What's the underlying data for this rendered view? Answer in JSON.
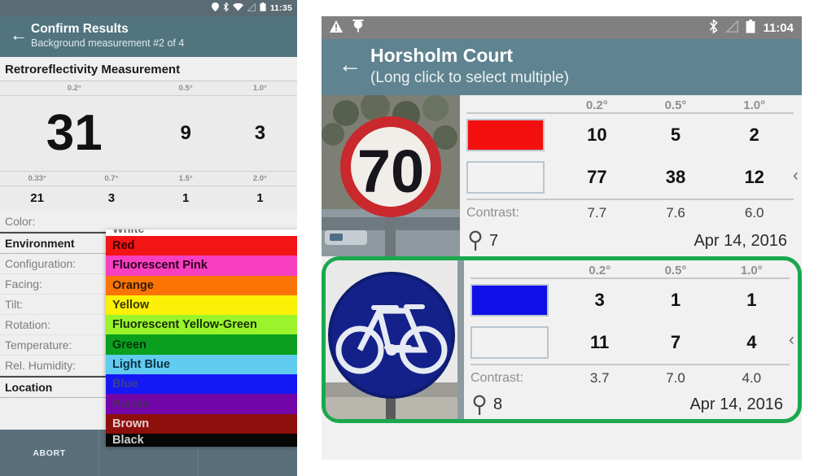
{
  "left_phone": {
    "statusbar": {
      "icons": [
        "location-pin-icon",
        "bluetooth-icon",
        "wifi-icon",
        "signal-icon",
        "battery-icon"
      ],
      "time": "11:35"
    },
    "appbar": {
      "back_icon": "back-arrow-icon",
      "title": "Confirm Results",
      "subtitle": "Background measurement #2 of 4"
    },
    "section_title": "Retroreflectivity Measurement",
    "measurement": {
      "angles_row1": [
        "0.2°",
        "0.5°",
        "1.0°"
      ],
      "values_row1": [
        "31",
        "9",
        "3"
      ],
      "angles_row2": [
        "0.33°",
        "0.7°",
        "1.5°",
        "2.0°"
      ],
      "values_row2": [
        "21",
        "3",
        "1",
        "1"
      ]
    },
    "fields": [
      {
        "label": "Color:",
        "value": ""
      },
      {
        "label": "Environment",
        "value": "",
        "header": true
      },
      {
        "label": "Configuration:",
        "value": ""
      },
      {
        "label": "Facing:",
        "value": ""
      },
      {
        "label": "Tilt:",
        "value": ""
      },
      {
        "label": "Rotation:",
        "value": ""
      },
      {
        "label": "Temperature:",
        "value": ""
      },
      {
        "label": "Rel. Humidity:",
        "value": ""
      },
      {
        "label": "Location",
        "value": "",
        "header": true
      }
    ],
    "buttons": [
      {
        "label": "ABORT"
      },
      {
        "label": ""
      },
      {
        "label": ""
      }
    ],
    "color_dropdown": {
      "items": [
        {
          "label": "White",
          "bg": "#ffffff",
          "fg": "#6b6b6b"
        },
        {
          "label": "Red",
          "bg": "#f21515",
          "fg": "#3a0000"
        },
        {
          "label": "Fluorescent Pink",
          "bg": "#f73fc0",
          "fg": "#2b0021"
        },
        {
          "label": "Orange",
          "bg": "#fb7406",
          "fg": "#3a1a00"
        },
        {
          "label": "Yellow",
          "bg": "#fcf106",
          "fg": "#3a3600"
        },
        {
          "label": "Fluorescent Yellow-Green",
          "bg": "#9bf32b",
          "fg": "#17300a"
        },
        {
          "label": "Green",
          "bg": "#0aa01d",
          "fg": "#03330a"
        },
        {
          "label": "Light Blue",
          "bg": "#62cbf0",
          "fg": "#0b3140"
        },
        {
          "label": "Blue",
          "bg": "#1419f4",
          "fg": "#3d3f8c"
        },
        {
          "label": "Purple",
          "bg": "#7306a8",
          "fg": "#4a2a63"
        },
        {
          "label": "Brown",
          "bg": "#8d0f0c",
          "fg": "#e7cfcf"
        },
        {
          "label": "Black",
          "bg": "#060606",
          "fg": "#cfcfcf"
        }
      ]
    }
  },
  "right_phone": {
    "statusbar": {
      "left_icons": [
        "warning-triangle-icon",
        "gps-location-icon"
      ],
      "right_icons": [
        "bluetooth-icon",
        "signal-icon",
        "battery-icon"
      ],
      "time": "11:04"
    },
    "appbar": {
      "back_icon": "back-arrow-icon",
      "title": "Horsholm Court",
      "subtitle": "(Long click to select multiple)"
    },
    "angle_headers": [
      "0.2°",
      "0.5°",
      "1.0°"
    ],
    "contrast_label": "Contrast:",
    "selection_color": "#1aa84f",
    "cards": [
      {
        "sign_type": "speed-limit-70-sign",
        "sign_text": "70",
        "selected": false,
        "swatch_color": "#f40f0f",
        "swatch_color2": "#f2f2f2",
        "values_color": [
          "10",
          "5",
          "2"
        ],
        "values_white": [
          "77",
          "38",
          "12"
        ],
        "contrast": [
          "7.7",
          "7.6",
          "6.0"
        ],
        "marker_number": "7",
        "date": "Apr 14, 2016",
        "chevron": "‹"
      },
      {
        "sign_type": "bicycle-route-sign",
        "sign_text": "",
        "selected": true,
        "swatch_color": "#1210e8",
        "swatch_color2": "#f2f2f2",
        "values_color": [
          "3",
          "1",
          "1"
        ],
        "values_white": [
          "11",
          "7",
          "4"
        ],
        "contrast": [
          "3.7",
          "7.0",
          "4.0"
        ],
        "marker_number": "8",
        "date": "Apr 14, 2016",
        "chevron": "‹"
      }
    ]
  }
}
